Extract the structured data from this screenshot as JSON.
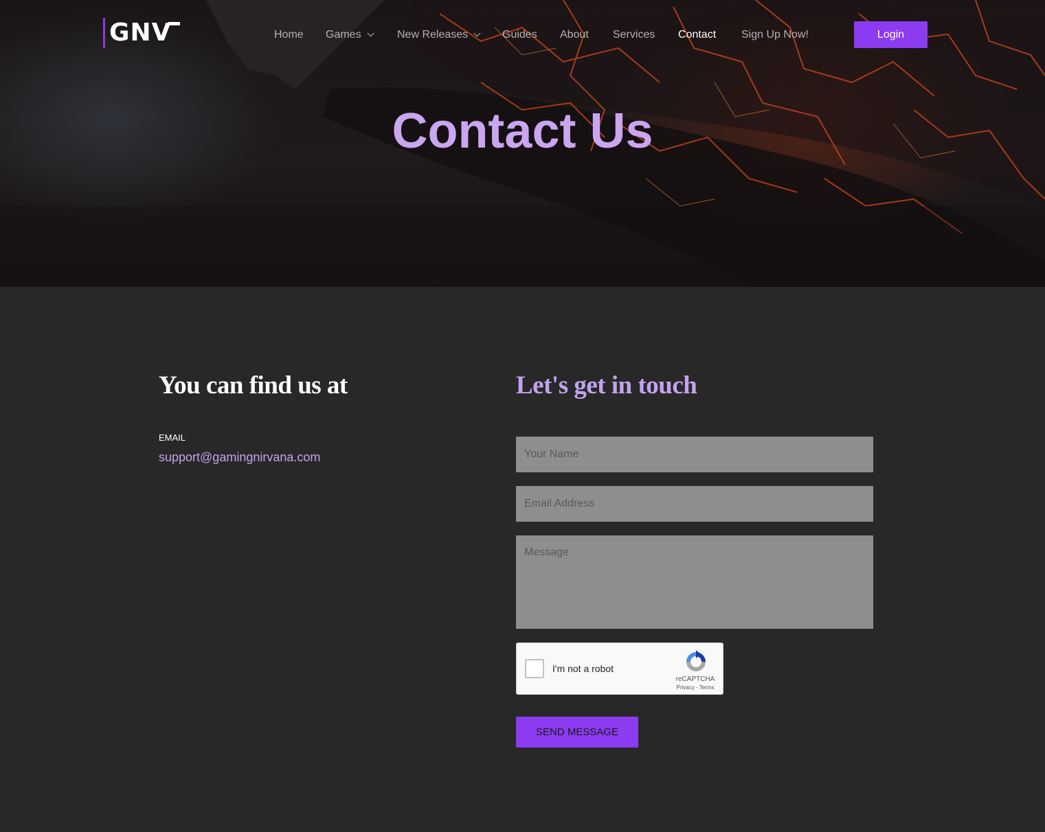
{
  "brand": {
    "logo_text": "GNV",
    "accent": "#8b3bf0"
  },
  "nav": {
    "items": [
      {
        "label": "Home"
      },
      {
        "label": "Games"
      },
      {
        "label": "New Releases"
      },
      {
        "label": "Guides"
      },
      {
        "label": "About"
      },
      {
        "label": "Services"
      },
      {
        "label": "Contact"
      },
      {
        "label": "Sign Up Now!"
      }
    ],
    "login_label": "Login"
  },
  "hero": {
    "title": "Contact Us"
  },
  "contact_info": {
    "heading": "You can find us at",
    "email_label": "EMAIL",
    "email_value": "support@gamingnirvana.com"
  },
  "form": {
    "heading": "Let's get in touch",
    "name_placeholder": "Your Name",
    "email_placeholder": "Email Address",
    "message_placeholder": "Message",
    "captcha": {
      "label": "I'm not a robot",
      "brand": "reCAPTCHA",
      "terms": "Privacy - Terms"
    },
    "submit_label": "SEND MESSAGE"
  },
  "colors": {
    "heading_purple": "#c3a3ee",
    "page_bg": "#282828",
    "input_bg": "#8e8e8e"
  }
}
